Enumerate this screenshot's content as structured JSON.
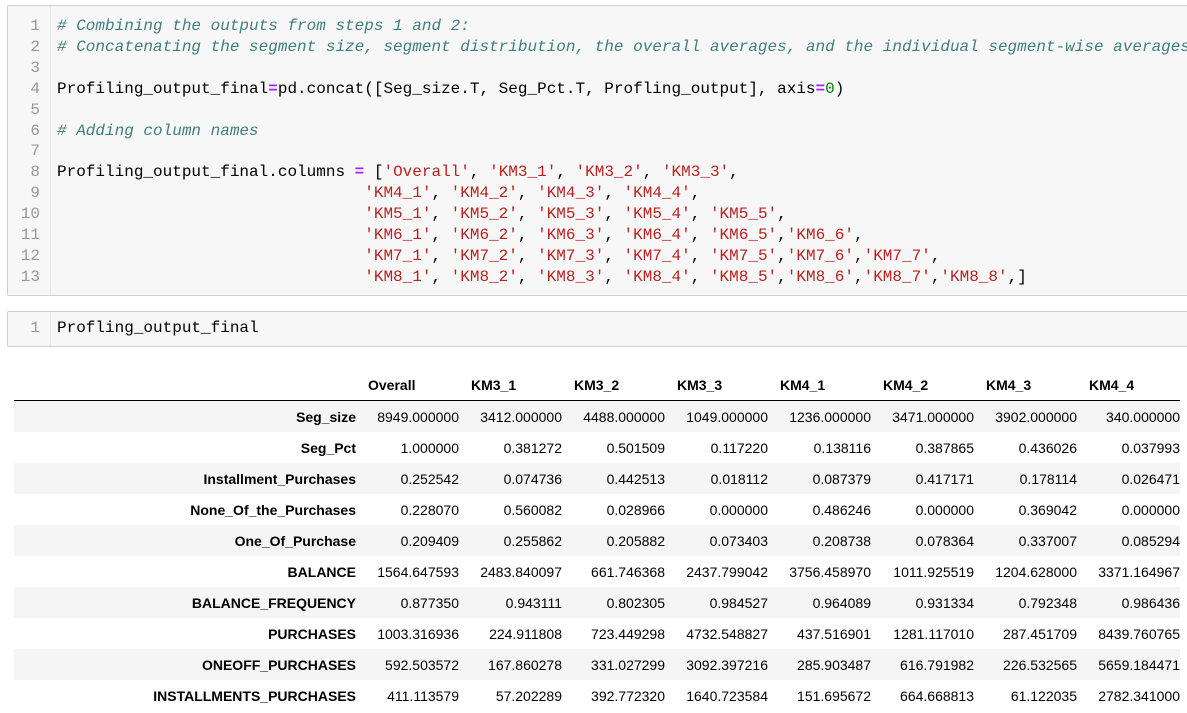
{
  "cells": [
    {
      "lines": [
        [
          [
            "comment",
            "# Combining the outputs from steps 1 and 2:"
          ]
        ],
        [
          [
            "comment",
            "# Concatenating the segment size, segment distribution, the overall averages, and the individual segment-wise averages"
          ]
        ],
        [],
        [
          [
            "plain",
            "Profiling_output_final"
          ],
          [
            "op",
            "="
          ],
          [
            "plain",
            "pd.concat([Seg_size.T, Seg_Pct.T, Profling_output], axis"
          ],
          [
            "op",
            "="
          ],
          [
            "num",
            "0"
          ],
          [
            "plain",
            ")"
          ]
        ],
        [],
        [
          [
            "comment",
            "# Adding column names"
          ]
        ],
        [],
        [
          [
            "plain",
            "Profiling_output_final.columns "
          ],
          [
            "op",
            "="
          ],
          [
            "plain",
            " ["
          ],
          [
            "string",
            "'Overall'"
          ],
          [
            "plain",
            ", "
          ],
          [
            "string",
            "'KM3_1'"
          ],
          [
            "plain",
            ", "
          ],
          [
            "string",
            "'KM3_2'"
          ],
          [
            "plain",
            ", "
          ],
          [
            "string",
            "'KM3_3'"
          ],
          [
            "plain",
            ","
          ]
        ],
        [
          [
            "plain",
            "                                "
          ],
          [
            "string",
            "'KM4_1'"
          ],
          [
            "plain",
            ", "
          ],
          [
            "string",
            "'KM4_2'"
          ],
          [
            "plain",
            ", "
          ],
          [
            "string",
            "'KM4_3'"
          ],
          [
            "plain",
            ", "
          ],
          [
            "string",
            "'KM4_4'"
          ],
          [
            "plain",
            ","
          ]
        ],
        [
          [
            "plain",
            "                                "
          ],
          [
            "string",
            "'KM5_1'"
          ],
          [
            "plain",
            ", "
          ],
          [
            "string",
            "'KM5_2'"
          ],
          [
            "plain",
            ", "
          ],
          [
            "string",
            "'KM5_3'"
          ],
          [
            "plain",
            ", "
          ],
          [
            "string",
            "'KM5_4'"
          ],
          [
            "plain",
            ", "
          ],
          [
            "string",
            "'KM5_5'"
          ],
          [
            "plain",
            ","
          ]
        ],
        [
          [
            "plain",
            "                                "
          ],
          [
            "string",
            "'KM6_1'"
          ],
          [
            "plain",
            ", "
          ],
          [
            "string",
            "'KM6_2'"
          ],
          [
            "plain",
            ", "
          ],
          [
            "string",
            "'KM6_3'"
          ],
          [
            "plain",
            ", "
          ],
          [
            "string",
            "'KM6_4'"
          ],
          [
            "plain",
            ", "
          ],
          [
            "string",
            "'KM6_5'"
          ],
          [
            "plain",
            ","
          ],
          [
            "string",
            "'KM6_6'"
          ],
          [
            "plain",
            ","
          ]
        ],
        [
          [
            "plain",
            "                                "
          ],
          [
            "string",
            "'KM7_1'"
          ],
          [
            "plain",
            ", "
          ],
          [
            "string",
            "'KM7_2'"
          ],
          [
            "plain",
            ", "
          ],
          [
            "string",
            "'KM7_3'"
          ],
          [
            "plain",
            ", "
          ],
          [
            "string",
            "'KM7_4'"
          ],
          [
            "plain",
            ", "
          ],
          [
            "string",
            "'KM7_5'"
          ],
          [
            "plain",
            ","
          ],
          [
            "string",
            "'KM7_6'"
          ],
          [
            "plain",
            ","
          ],
          [
            "string",
            "'KM7_7'"
          ],
          [
            "plain",
            ","
          ]
        ],
        [
          [
            "plain",
            "                                "
          ],
          [
            "string",
            "'KM8_1'"
          ],
          [
            "plain",
            ", "
          ],
          [
            "string",
            "'KM8_2'"
          ],
          [
            "plain",
            ", "
          ],
          [
            "string",
            "'KM8_3'"
          ],
          [
            "plain",
            ", "
          ],
          [
            "string",
            "'KM8_4'"
          ],
          [
            "plain",
            ", "
          ],
          [
            "string",
            "'KM8_5'"
          ],
          [
            "plain",
            ","
          ],
          [
            "string",
            "'KM8_6'"
          ],
          [
            "plain",
            ","
          ],
          [
            "string",
            "'KM8_7'"
          ],
          [
            "plain",
            ","
          ],
          [
            "string",
            "'KM8_8'"
          ],
          [
            "plain",
            ",]"
          ]
        ]
      ]
    },
    {
      "lines": [
        [
          [
            "plain",
            "Profling_output_final"
          ]
        ]
      ]
    }
  ],
  "output_table": {
    "columns": [
      "Overall",
      "KM3_1",
      "KM3_2",
      "KM3_3",
      "KM4_1",
      "KM4_2",
      "KM4_3",
      "KM4_4"
    ],
    "rows": [
      {
        "index": "Seg_size",
        "values": [
          "8949.000000",
          "3412.000000",
          "4488.000000",
          "1049.000000",
          "1236.000000",
          "3471.000000",
          "3902.000000",
          "340.000000"
        ]
      },
      {
        "index": "Seg_Pct",
        "values": [
          "1.000000",
          "0.381272",
          "0.501509",
          "0.117220",
          "0.138116",
          "0.387865",
          "0.436026",
          "0.037993"
        ]
      },
      {
        "index": "Installment_Purchases",
        "values": [
          "0.252542",
          "0.074736",
          "0.442513",
          "0.018112",
          "0.087379",
          "0.417171",
          "0.178114",
          "0.026471"
        ]
      },
      {
        "index": "None_Of_the_Purchases",
        "values": [
          "0.228070",
          "0.560082",
          "0.028966",
          "0.000000",
          "0.486246",
          "0.000000",
          "0.369042",
          "0.000000"
        ]
      },
      {
        "index": "One_Of_Purchase",
        "values": [
          "0.209409",
          "0.255862",
          "0.205882",
          "0.073403",
          "0.208738",
          "0.078364",
          "0.337007",
          "0.085294"
        ]
      },
      {
        "index": "BALANCE",
        "values": [
          "1564.647593",
          "2483.840097",
          "661.746368",
          "2437.799042",
          "3756.458970",
          "1011.925519",
          "1204.628000",
          "3371.164967"
        ]
      },
      {
        "index": "BALANCE_FREQUENCY",
        "values": [
          "0.877350",
          "0.943111",
          "0.802305",
          "0.984527",
          "0.964089",
          "0.931334",
          "0.792348",
          "0.986436"
        ]
      },
      {
        "index": "PURCHASES",
        "values": [
          "1003.316936",
          "224.911808",
          "723.449298",
          "4732.548827",
          "437.516901",
          "1281.117010",
          "287.451709",
          "8439.760765"
        ]
      },
      {
        "index": "ONEOFF_PURCHASES",
        "values": [
          "592.503572",
          "167.860278",
          "331.027299",
          "3092.397216",
          "285.903487",
          "616.791982",
          "226.532565",
          "5659.184471"
        ]
      },
      {
        "index": "INSTALLMENTS_PURCHASES",
        "values": [
          "411.113579",
          "57.202289",
          "392.772320",
          "1640.723584",
          "151.695672",
          "664.668813",
          "61.122035",
          "2782.341000"
        ]
      }
    ]
  }
}
